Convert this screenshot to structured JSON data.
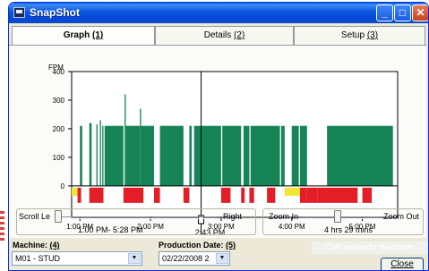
{
  "window": {
    "title": "SnapShot"
  },
  "caption_buttons": {
    "minimize": "_",
    "maximize": "□",
    "close": "✕"
  },
  "tabs": [
    {
      "label": "Graph",
      "key": "(1)",
      "active": true
    },
    {
      "label": "Details",
      "key": "(2)",
      "active": false
    },
    {
      "label": "Setup",
      "key": "(3)",
      "active": false
    }
  ],
  "chart_data": {
    "type": "bar",
    "ylabel": "FPM",
    "ylim": [
      -110,
      400
    ],
    "yticks": [
      0,
      100,
      200,
      300,
      400
    ],
    "xlim_minutes": [
      773,
      1050
    ],
    "xtick_labels": [
      "1:00 PM",
      "2:00 PM",
      "3:00 PM",
      "4:00 PM",
      "5:00 PM"
    ],
    "cursor_label": "2:43 PM",
    "cursor_time_minutes": 883,
    "colors": {
      "speed": "#168456",
      "down_red": "#e41e26",
      "down_yellow": "#f0e633",
      "baseline": "#000000"
    },
    "speed_segments": [
      {
        "start": 780,
        "end": 782,
        "value": 210
      },
      {
        "start": 788,
        "end": 790,
        "value": 220
      },
      {
        "start": 794,
        "end": 795,
        "value": 215
      },
      {
        "start": 797,
        "end": 798,
        "value": 230
      },
      {
        "start": 799,
        "end": 800,
        "value": 210
      },
      {
        "start": 801,
        "end": 817,
        "value": 210
      },
      {
        "start": 818,
        "end": 819,
        "value": 320
      },
      {
        "start": 819,
        "end": 831,
        "value": 210
      },
      {
        "start": 831,
        "end": 832,
        "value": 270
      },
      {
        "start": 832,
        "end": 843,
        "value": 210
      },
      {
        "start": 848,
        "end": 868,
        "value": 210
      },
      {
        "start": 873,
        "end": 875,
        "value": 210
      },
      {
        "start": 877,
        "end": 900,
        "value": 210
      },
      {
        "start": 901,
        "end": 917,
        "value": 210
      },
      {
        "start": 919,
        "end": 924,
        "value": 210
      },
      {
        "start": 925,
        "end": 950,
        "value": 210
      },
      {
        "start": 951,
        "end": 954,
        "value": 210
      },
      {
        "start": 960,
        "end": 966,
        "value": 210
      },
      {
        "start": 967,
        "end": 973,
        "value": 210
      },
      {
        "start": 990,
        "end": 1046,
        "value": 210
      }
    ],
    "downtime_segments": [
      {
        "start": 773,
        "end": 778,
        "color": "yellow"
      },
      {
        "start": 778,
        "end": 781,
        "color": "red"
      },
      {
        "start": 788,
        "end": 800,
        "color": "red"
      },
      {
        "start": 817,
        "end": 834,
        "color": "red"
      },
      {
        "start": 843,
        "end": 848,
        "color": "red"
      },
      {
        "start": 868,
        "end": 873,
        "color": "red"
      },
      {
        "start": 900,
        "end": 908,
        "color": "red"
      },
      {
        "start": 917,
        "end": 920,
        "color": "red"
      },
      {
        "start": 924,
        "end": 928,
        "color": "red"
      },
      {
        "start": 939,
        "end": 946,
        "color": "red"
      },
      {
        "start": 954,
        "end": 967,
        "color": "yellow"
      },
      {
        "start": 967,
        "end": 973,
        "color": "red"
      },
      {
        "start": 973,
        "end": 982,
        "color": "red"
      },
      {
        "start": 982,
        "end": 1016,
        "color": "red"
      },
      {
        "start": 1020,
        "end": 1028,
        "color": "red"
      }
    ]
  },
  "scroll": {
    "left_label": "Scroll Le",
    "right_label": "Right",
    "range_text": "1:00 PM- 5:28 PM",
    "position": 0.02
  },
  "zoom": {
    "in_label": "Zoom In",
    "out_label": "Zoom Out",
    "value_text": "4 hrs 29 mins",
    "position": 0.45
  },
  "machine": {
    "label": "Machine:",
    "key": "(4)",
    "value": "M01 - STUD"
  },
  "production_date": {
    "label": "Production Date:",
    "key": "(5)",
    "value": "02/22/2008 2"
  },
  "hint": "Click on bars for description",
  "close_label": "Close"
}
